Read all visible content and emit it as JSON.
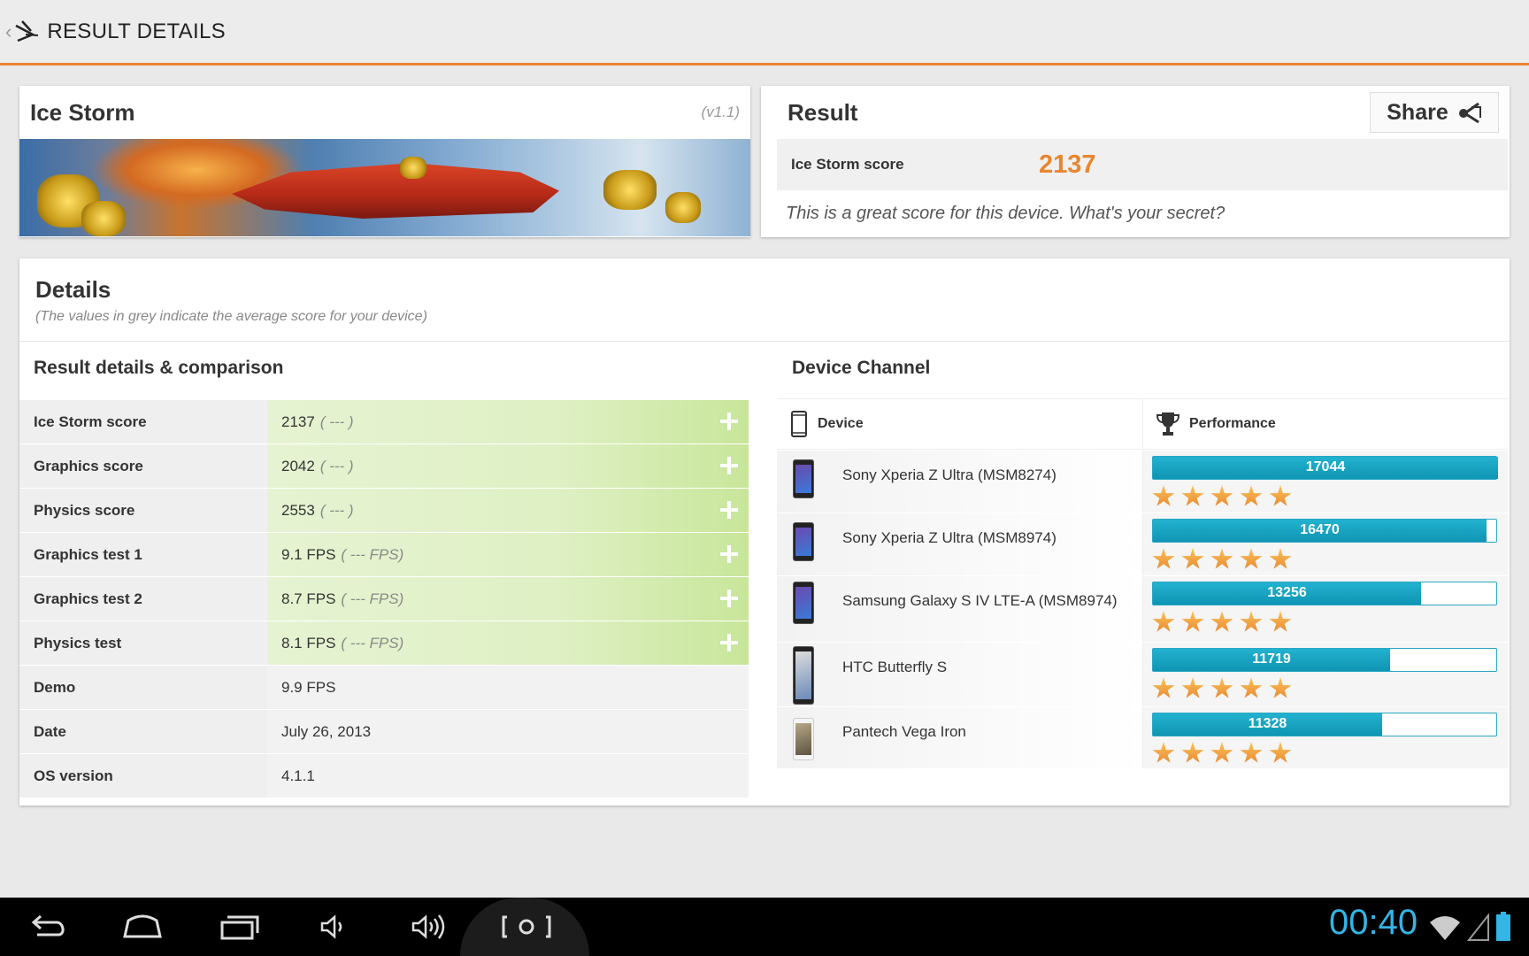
{
  "header": {
    "title": "RESULT DETAILS"
  },
  "benchmark": {
    "name": "Ice Storm",
    "version": "(v1.1)"
  },
  "result": {
    "title": "Result",
    "share_label": "Share",
    "score_label": "Ice Storm score",
    "score_value": "2137",
    "message": "This is a great score for this device. What's your secret?"
  },
  "details": {
    "title": "Details",
    "subtitle": "(The values in grey indicate the average score for your device)",
    "comparison_title": "Result details & comparison",
    "rows": [
      {
        "label": "Ice Storm score",
        "value": "2137",
        "avg": "( --- )",
        "expandable": true
      },
      {
        "label": "Graphics score",
        "value": "2042",
        "avg": "( --- )",
        "expandable": true
      },
      {
        "label": "Physics score",
        "value": "2553",
        "avg": "( --- )",
        "expandable": true
      },
      {
        "label": "Graphics test 1",
        "value": "9.1 FPS",
        "avg": "( --- FPS)",
        "expandable": true
      },
      {
        "label": "Graphics test 2",
        "value": "8.7 FPS",
        "avg": "( --- FPS)",
        "expandable": true
      },
      {
        "label": "Physics test",
        "value": "8.1 FPS",
        "avg": "( --- FPS)",
        "expandable": true
      },
      {
        "label": "Demo",
        "value": "9.9 FPS",
        "avg": "",
        "expandable": false
      },
      {
        "label": "Date",
        "value": "July 26, 2013",
        "avg": "",
        "expandable": false
      },
      {
        "label": "OS version",
        "value": "4.1.1",
        "avg": "",
        "expandable": false
      }
    ]
  },
  "device_channel": {
    "title": "Device Channel",
    "col_device": "Device",
    "col_performance": "Performance",
    "max_score": 17044,
    "devices": [
      {
        "name": "Sony Xperia Z Ultra (MSM8274)",
        "score": 17044,
        "score_text": "17044",
        "stars": 5
      },
      {
        "name": "Sony Xperia Z Ultra (MSM8974)",
        "score": 16470,
        "score_text": "16470",
        "stars": 5
      },
      {
        "name": "Samsung Galaxy S IV LTE-A (MSM8974)",
        "score": 13256,
        "score_text": "13256",
        "stars": 5
      },
      {
        "name": "HTC Butterfly S",
        "score": 11719,
        "score_text": "11719",
        "stars": 5
      },
      {
        "name": "Pantech Vega Iron",
        "score": 11328,
        "score_text": "11328",
        "stars": 5
      }
    ]
  },
  "statusbar": {
    "time": "00:40"
  },
  "colors": {
    "accent": "#e8862f",
    "bar": "#1aa3c1",
    "clock": "#33b5e5"
  },
  "icons": {
    "back": "chevron-left-icon",
    "app_logo": "3dmark-logo-icon",
    "share": "share-icon",
    "device": "phone-icon",
    "performance": "trophy-icon",
    "expand": "plus-icon",
    "star": "star-icon"
  }
}
